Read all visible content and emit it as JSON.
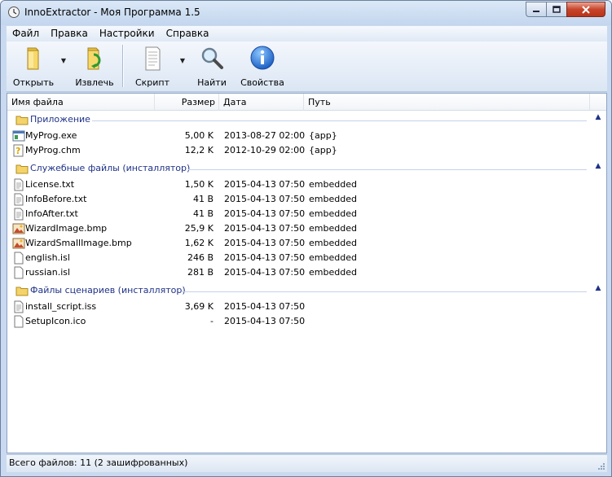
{
  "window": {
    "title": "InnoExtractor - Моя Программа 1.5"
  },
  "menu": [
    {
      "label": "Файл"
    },
    {
      "label": "Правка"
    },
    {
      "label": "Настройки"
    },
    {
      "label": "Справка"
    }
  ],
  "toolbar": {
    "open_label": "Открыть",
    "extract_label": "Извлечь",
    "script_label": "Скрипт",
    "find_label": "Найти",
    "properties_label": "Свойства"
  },
  "columns": {
    "name": "Имя файла",
    "size": "Размер",
    "date": "Дата",
    "path": "Путь"
  },
  "groups": [
    {
      "title": "Приложение",
      "files": [
        {
          "name": "MyProg.exe",
          "size": "5,00 K",
          "date": "2013-08-27 02:00",
          "path": "{app}",
          "icon": "exe-icon"
        },
        {
          "name": "MyProg.chm",
          "size": "12,2 K",
          "date": "2012-10-29 02:00",
          "path": "{app}",
          "icon": "chm-help-icon"
        }
      ]
    },
    {
      "title": "Служебные файлы (инсталлятор)",
      "files": [
        {
          "name": "License.txt",
          "size": "1,50 K",
          "date": "2015-04-13 07:50",
          "path": "embedded",
          "icon": "text-file-icon"
        },
        {
          "name": "InfoBefore.txt",
          "size": "41 B",
          "date": "2015-04-13 07:50",
          "path": "embedded",
          "icon": "text-file-icon"
        },
        {
          "name": "InfoAfter.txt",
          "size": "41 B",
          "date": "2015-04-13 07:50",
          "path": "embedded",
          "icon": "text-file-icon"
        },
        {
          "name": "WizardImage.bmp",
          "size": "25,9 K",
          "date": "2015-04-13 07:50",
          "path": "embedded",
          "icon": "bitmap-file-icon"
        },
        {
          "name": "WizardSmallImage.bmp",
          "size": "1,62 K",
          "date": "2015-04-13 07:50",
          "path": "embedded",
          "icon": "bitmap-file-icon"
        },
        {
          "name": "english.isl",
          "size": "246 B",
          "date": "2015-04-13 07:50",
          "path": "embedded",
          "icon": "blank-file-icon"
        },
        {
          "name": "russian.isl",
          "size": "281 B",
          "date": "2015-04-13 07:50",
          "path": "embedded",
          "icon": "blank-file-icon"
        }
      ]
    },
    {
      "title": "Файлы сценариев (инсталлятор)",
      "files": [
        {
          "name": "install_script.iss",
          "size": "3,69 K",
          "date": "2015-04-13 07:50",
          "path": "",
          "icon": "text-file-icon"
        },
        {
          "name": "SetupIcon.ico",
          "size": "-",
          "date": "2015-04-13 07:50",
          "path": "",
          "icon": "blank-file-icon"
        }
      ]
    }
  ],
  "status": {
    "text": "Всего файлов: 11 (2 зашифрованных)"
  },
  "colors": {
    "group_title": "#1e3287",
    "group_line": "#c5d2ea",
    "window_frame": "#c9daf0"
  }
}
